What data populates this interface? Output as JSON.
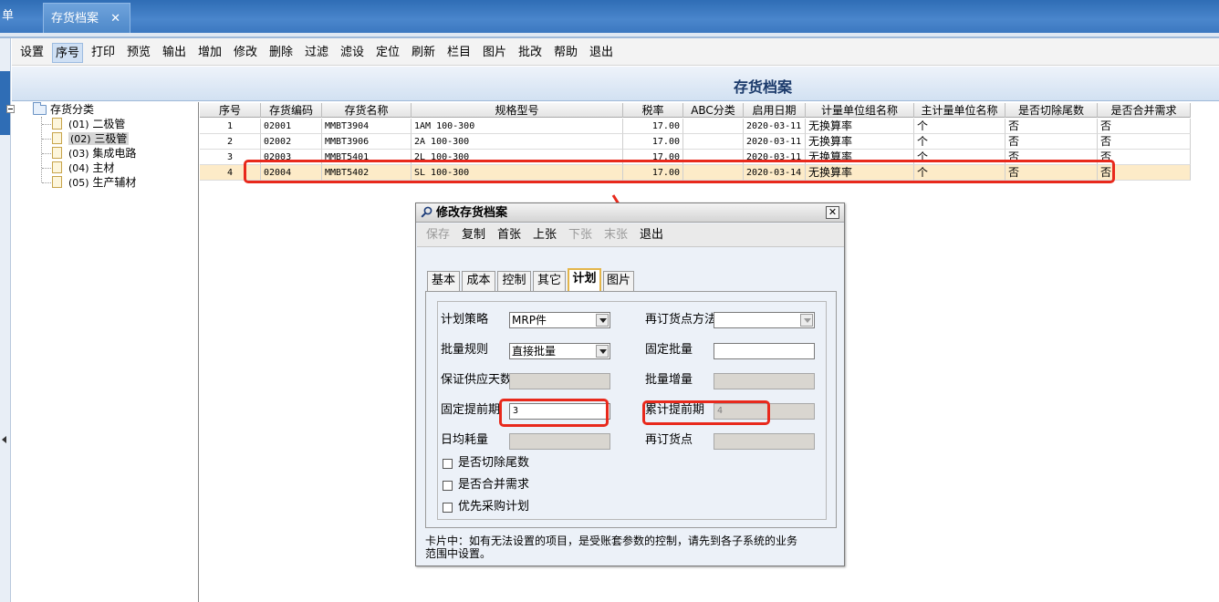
{
  "tabstrip": {
    "left_fragment": "单",
    "active_tab": "存货档案",
    "close_glyph": "✕"
  },
  "toolbar": {
    "items": [
      "设置",
      "序号",
      "打印",
      "预览",
      "输出",
      "增加",
      "修改",
      "删除",
      "过滤",
      "滤设",
      "定位",
      "刷新",
      "栏目",
      "图片",
      "批改",
      "帮助",
      "退出"
    ],
    "active_item": "序号"
  },
  "page_title": "存货档案",
  "tree": {
    "root_label": "存货分类",
    "nodes": [
      {
        "code": "(01)",
        "name": "二极管",
        "selected": false
      },
      {
        "code": "(02)",
        "name": "三极管",
        "selected": true
      },
      {
        "code": "(03)",
        "name": "集成电路",
        "selected": false
      },
      {
        "code": "(04)",
        "name": "主材",
        "selected": false
      },
      {
        "code": "(05)",
        "name": "生产辅材",
        "selected": false
      }
    ]
  },
  "grid": {
    "columns": [
      "序号",
      "存货编码",
      "存货名称",
      "规格型号",
      "税率",
      "ABC分类",
      "启用日期",
      "计量单位组名称",
      "主计量单位名称",
      "是否切除尾数",
      "是否合并需求"
    ],
    "rows": [
      {
        "no": "1",
        "code": "02001",
        "name": "MMBT3904",
        "spec": "1AM 100-300",
        "tax": "17.00",
        "abc": "",
        "date": "2020-03-11",
        "unit_group": "无换算率",
        "main_unit": "个",
        "cut_tail": "否",
        "merge": "否"
      },
      {
        "no": "2",
        "code": "02002",
        "name": "MMBT3906",
        "spec": "2A 100-300",
        "tax": "17.00",
        "abc": "",
        "date": "2020-03-11",
        "unit_group": "无换算率",
        "main_unit": "个",
        "cut_tail": "否",
        "merge": "否"
      },
      {
        "no": "3",
        "code": "02003",
        "name": "MMBT5401",
        "spec": "2L 100-300",
        "tax": "17.00",
        "abc": "",
        "date": "2020-03-11",
        "unit_group": "无换算率",
        "main_unit": "个",
        "cut_tail": "否",
        "merge": "否"
      },
      {
        "no": "4",
        "code": "02004",
        "name": "MMBT5402",
        "spec": "SL 100-300",
        "tax": "17.00",
        "abc": "",
        "date": "2020-03-14",
        "unit_group": "无换算率",
        "main_unit": "个",
        "cut_tail": "否",
        "merge": "否"
      }
    ],
    "selected_row": 4
  },
  "dialog": {
    "title": "修改存货档案",
    "close_glyph": "✕",
    "toolbar": [
      {
        "label": "保存",
        "enabled": false
      },
      {
        "label": "复制",
        "enabled": true
      },
      {
        "label": "首张",
        "enabled": true
      },
      {
        "label": "上张",
        "enabled": true
      },
      {
        "label": "下张",
        "enabled": false
      },
      {
        "label": "末张",
        "enabled": false
      },
      {
        "label": "退出",
        "enabled": true
      }
    ],
    "tabs": [
      "基本",
      "成本",
      "控制",
      "其它",
      "计划",
      "图片"
    ],
    "active_tab": "计划",
    "fields": {
      "plan_strategy_label": "计划策略",
      "plan_strategy_value": "MRP件",
      "reorder_method_label": "再订货点方法",
      "reorder_method_value": "",
      "batch_rule_label": "批量规则",
      "batch_rule_value": "直接批量",
      "fixed_batch_label": "固定批量",
      "fixed_batch_value": "",
      "supply_days_label": "保证供应天数",
      "supply_days_value": "",
      "batch_increment_label": "批量增量",
      "batch_increment_value": "",
      "fixed_lead_label": "固定提前期",
      "fixed_lead_value": "3",
      "cum_lead_label": "累计提前期",
      "cum_lead_value": "4",
      "daily_usage_label": "日均耗量",
      "daily_usage_value": "",
      "reorder_point_label": "再订货点",
      "reorder_point_value": ""
    },
    "checkboxes": [
      {
        "label": "是否切除尾数",
        "checked": false
      },
      {
        "label": "是否合并需求",
        "checked": false
      },
      {
        "label": "优先采购计划",
        "checked": false
      }
    ],
    "footer_line1": "卡片中：如有无法设置的项目，是受账套参数的控制，请先到各子系统的业务",
    "footer_line2": "范围中设置。"
  },
  "annotations": {
    "highlight_color": "#e8291c"
  }
}
